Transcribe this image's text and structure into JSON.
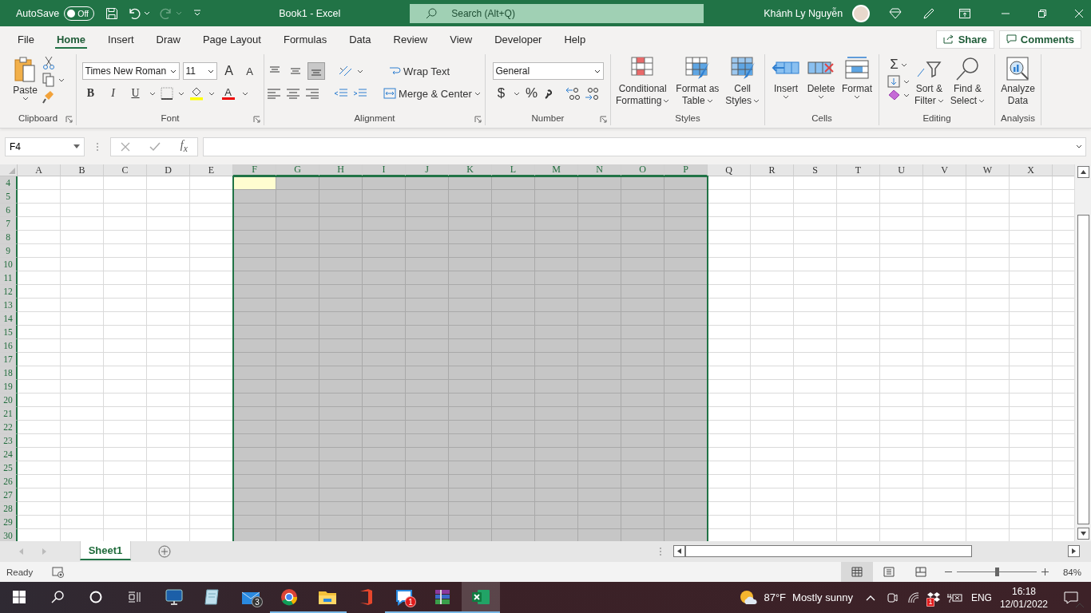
{
  "title_bar": {
    "autosave_label": "AutoSave",
    "autosave": {
      "label": "Off",
      "on": false
    },
    "title": "Book1  -  Excel",
    "search_placeholder": "Search (Alt+Q)",
    "user_name": "Khánh Ly Nguyễn"
  },
  "menu_tabs": [
    {
      "label": "File",
      "selected": false
    },
    {
      "label": "Home",
      "selected": true
    },
    {
      "label": "Insert",
      "selected": false
    },
    {
      "label": "Draw",
      "selected": false
    },
    {
      "label": "Page Layout",
      "selected": false
    },
    {
      "label": "Formulas",
      "selected": false
    },
    {
      "label": "Data",
      "selected": false
    },
    {
      "label": "Review",
      "selected": false
    },
    {
      "label": "View",
      "selected": false
    },
    {
      "label": "Developer",
      "selected": false
    },
    {
      "label": "Help",
      "selected": false
    }
  ],
  "share_button": "Share",
  "comments_button": "Comments",
  "ribbon": {
    "clipboard": {
      "label": "Clipboard",
      "paste": "Paste"
    },
    "font": {
      "label": "Font",
      "font_name": "Times New Roman",
      "font_size": "11",
      "bold": "B",
      "italic": "I",
      "underline": "U",
      "grow": "A",
      "shrink": "A",
      "font_color": "A"
    },
    "alignment": {
      "label": "Alignment",
      "vertical": [
        {
          "selected": false
        },
        {
          "selected": false
        },
        {
          "selected": true
        }
      ],
      "wrap_text": "Wrap Text",
      "merge_center": "Merge & Center"
    },
    "number": {
      "label": "Number",
      "format": "General",
      "currency": "$",
      "percent": "%"
    },
    "styles": {
      "label": "Styles",
      "buttons": [
        {
          "lines": [
            "Conditional",
            "Formatting"
          ]
        },
        {
          "lines": [
            "Format as",
            "Table"
          ]
        },
        {
          "lines": [
            "Cell",
            "Styles"
          ]
        }
      ]
    },
    "cells": {
      "label": "Cells",
      "buttons": [
        {
          "lines": [
            "Insert"
          ]
        },
        {
          "lines": [
            "Delete"
          ]
        },
        {
          "lines": [
            "Format"
          ]
        }
      ]
    },
    "editing": {
      "label": "Editing",
      "sum": "Σ",
      "buttons": [
        {
          "lines": [
            "Sort &",
            "Filter"
          ]
        },
        {
          "lines": [
            "Find &",
            "Select"
          ]
        }
      ]
    },
    "analysis": {
      "label": "Analysis",
      "buttons": [
        {
          "lines": [
            "Analyze",
            "Data"
          ]
        }
      ]
    }
  },
  "formula_bar": {
    "name_box": "F4",
    "function_label": "f$_{x}$"
  },
  "sheet": {
    "columns": [
      {
        "label": "A",
        "selected": false
      },
      {
        "label": "B",
        "selected": false
      },
      {
        "label": "C",
        "selected": false
      },
      {
        "label": "D",
        "selected": false
      },
      {
        "label": "E",
        "selected": false
      },
      {
        "label": "F",
        "selected": true
      },
      {
        "label": "G",
        "selected": true
      },
      {
        "label": "H",
        "selected": true
      },
      {
        "label": "I",
        "selected": true
      },
      {
        "label": "J",
        "selected": true
      },
      {
        "label": "K",
        "selected": true
      },
      {
        "label": "L",
        "selected": true
      },
      {
        "label": "M",
        "selected": true
      },
      {
        "label": "N",
        "selected": true
      },
      {
        "label": "O",
        "selected": true
      },
      {
        "label": "P",
        "selected": true
      },
      {
        "label": "Q",
        "selected": false
      },
      {
        "label": "R",
        "selected": false
      },
      {
        "label": "S",
        "selected": false
      },
      {
        "label": "T",
        "selected": false
      },
      {
        "label": "U",
        "selected": false
      },
      {
        "label": "V",
        "selected": false
      },
      {
        "label": "W",
        "selected": false
      },
      {
        "label": "X",
        "selected": false
      }
    ],
    "rows": [
      {
        "label": "4",
        "selected": true
      },
      {
        "label": "5",
        "selected": true
      },
      {
        "label": "6",
        "selected": true
      },
      {
        "label": "7",
        "selected": true
      },
      {
        "label": "8",
        "selected": true
      },
      {
        "label": "9",
        "selected": true
      },
      {
        "label": "10",
        "selected": true
      },
      {
        "label": "11",
        "selected": true
      },
      {
        "label": "12",
        "selected": true
      },
      {
        "label": "13",
        "selected": true
      },
      {
        "label": "14",
        "selected": true
      },
      {
        "label": "15",
        "selected": true
      },
      {
        "label": "16",
        "selected": true
      },
      {
        "label": "17",
        "selected": true
      },
      {
        "label": "18",
        "selected": true
      },
      {
        "label": "19",
        "selected": true
      },
      {
        "label": "20",
        "selected": true
      },
      {
        "label": "21",
        "selected": true
      },
      {
        "label": "22",
        "selected": true
      },
      {
        "label": "23",
        "selected": true
      },
      {
        "label": "24",
        "selected": true
      },
      {
        "label": "25",
        "selected": true
      },
      {
        "label": "26",
        "selected": true
      },
      {
        "label": "27",
        "selected": true
      },
      {
        "label": "28",
        "selected": true
      },
      {
        "label": "29",
        "selected": true
      },
      {
        "label": "30",
        "selected": true
      }
    ]
  },
  "sheet_tabs": [
    {
      "label": "Sheet1",
      "selected": true
    }
  ],
  "status_bar": {
    "text": "Ready",
    "views": [
      {
        "selected": true
      },
      {
        "selected": false
      },
      {
        "selected": false
      }
    ],
    "zoom_slider": {
      "level": 0.5
    },
    "zoom": "84%"
  },
  "taskbar": {
    "apps": [
      {
        "kind": "remote",
        "running": false,
        "selected": false
      },
      {
        "kind": "notepad",
        "running": false,
        "selected": false
      },
      {
        "kind": "mail",
        "running": false,
        "selected": false,
        "badge": "3"
      },
      {
        "kind": "chrome",
        "running": true,
        "selected": false
      },
      {
        "kind": "explorer",
        "running": true,
        "selected": false
      },
      {
        "kind": "office",
        "running": false,
        "selected": false
      },
      {
        "kind": "zalo",
        "running": true,
        "selected": false,
        "badge": "1"
      },
      {
        "kind": "winrar",
        "running": true,
        "selected": false
      },
      {
        "kind": "excel",
        "running": true,
        "selected": true
      }
    ],
    "weather": {
      "temperature": "87°F",
      "condition": "Mostly sunny"
    },
    "tray_badge": "1",
    "language": "ENG",
    "time": "16:18",
    "date": "12/01/2022"
  }
}
